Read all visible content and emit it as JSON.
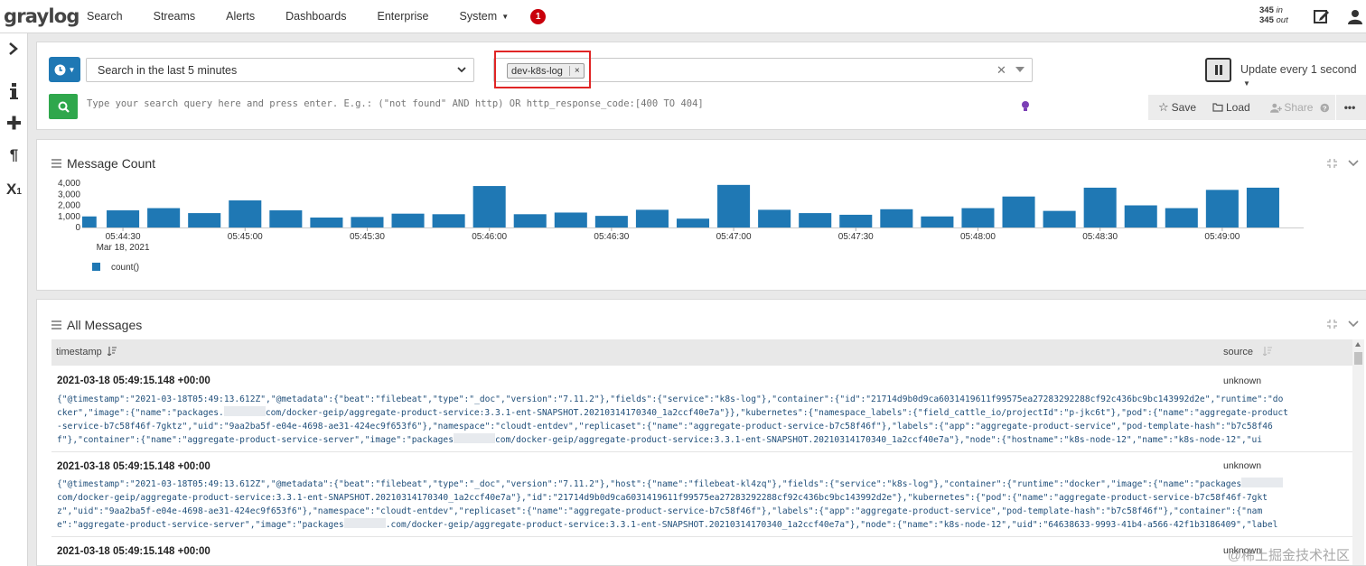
{
  "app": {
    "logo": "graylog"
  },
  "nav": {
    "items": [
      "Search",
      "Streams",
      "Alerts",
      "Dashboards",
      "Enterprise",
      "System"
    ],
    "notification_count": "1"
  },
  "throughput": {
    "in_value": "345",
    "in_label": "in",
    "out_value": "345",
    "out_label": "out"
  },
  "sidebar": {
    "icons": [
      "chevron-right-icon",
      "info-icon",
      "plus-icon",
      "paragraph-icon",
      "subscript-icon"
    ]
  },
  "search": {
    "time_range": "Search in the last 5 minutes",
    "stream_tag": "dev-k8s-log",
    "stream_tag_remove": "×",
    "stream_clear": "✕",
    "refresh_label": "Update every 1 second",
    "query_placeholder": "Type your search query here and press enter. E.g.: (\"not found\" AND http) OR http_response_code:[400 TO 404]",
    "query_value": "",
    "save_label": "Save",
    "load_label": "Load",
    "share_label": "Share"
  },
  "message_count": {
    "title": "Message Count",
    "date_label": "Mar 18, 2021",
    "legend": "count()"
  },
  "chart_data": {
    "type": "bar",
    "color": "#1f78b4",
    "ylim": [
      0,
      4000
    ],
    "y_ticks": [
      "0",
      "1,000",
      "2,000",
      "3,000",
      "4,000"
    ],
    "x_tick_labels": [
      "05:44:30",
      "05:45:00",
      "05:45:30",
      "05:46:00",
      "05:46:30",
      "05:47:00",
      "05:47:30",
      "05:48:00",
      "05:48:30",
      "05:49:00"
    ],
    "series": [
      {
        "name": "count()",
        "values": [
          1000,
          1550,
          1750,
          1300,
          2450,
          1550,
          900,
          950,
          1250,
          1200,
          3750,
          1200,
          1350,
          1050,
          1600,
          800,
          3850,
          1600,
          1300,
          1150,
          1650,
          1000,
          1750,
          2800,
          1500,
          3600,
          2000,
          1750,
          3400,
          3600
        ]
      }
    ],
    "grid": false,
    "legend_position": "bottom-left"
  },
  "all_messages": {
    "title": "All Messages",
    "col_timestamp": "timestamp",
    "col_source": "source",
    "rows": [
      {
        "timestamp": "2021-03-18 05:49:15.148 +00:00",
        "source": "unknown",
        "lines": [
          "{\"@timestamp\":\"2021-03-18T05:49:13.612Z\",\"@metadata\":{\"beat\":\"filebeat\",\"type\":\"_doc\",\"version\":\"7.11.2\"},\"fields\":{\"service\":\"k8s-log\"},\"container\":{\"id\":\"21714d9b0d9ca6031419611f99575ea27283292288cf92c436bc9bc143992d2e\",\"runtime\":\"do",
          "cker\",\"image\":{\"name\":\"packages.",
          "com/docker-geip/aggregate-product-service:3.3.1-ent-SNAPSHOT.20210314170340_1a2ccf40e7a\"}},\"kubernetes\":{\"namespace_labels\":{\"field_cattle_io/projectId\":\"p-jkc6t\"},\"pod\":{\"name\":\"aggregate-product",
          "-service-b7c58f46f-7gktz\",\"uid\":\"9aa2ba5f-e04e-4698-ae31-424ec9f653f6\"},\"namespace\":\"cloudt-entdev\",\"replicaset\":{\"name\":\"aggregate-product-service-b7c58f46f\"},\"labels\":{\"app\":\"aggregate-product-service\",\"pod-template-hash\":\"b7c58f46",
          "f\"},\"container\":{\"name\":\"aggregate-product-service-server\",\"image\":\"packages",
          "com/docker-geip/aggregate-product-service:3.3.1-ent-SNAPSHOT.20210314170340_1a2ccf40e7a\"},\"node\":{\"hostname\":\"k8s-node-12\",\"name\":\"k8s-node-12\",\"ui"
        ]
      },
      {
        "timestamp": "2021-03-18 05:49:15.148 +00:00",
        "source": "unknown",
        "lines": [
          "{\"@timestamp\":\"2021-03-18T05:49:13.612Z\",\"@metadata\":{\"beat\":\"filebeat\",\"type\":\"_doc\",\"version\":\"7.11.2\"},\"host\":{\"name\":\"filebeat-kl4zq\"},\"fields\":{\"service\":\"k8s-log\"},\"container\":{\"runtime\":\"docker\",\"image\":{\"name\":\"packages",
          "com/docker-geip/aggregate-product-service:3.3.1-ent-SNAPSHOT.20210314170340_1a2ccf40e7a\"},\"id\":\"21714d9b0d9ca6031419611f99575ea27283292288cf92c436bc9bc143992d2e\"},\"kubernetes\":{\"pod\":{\"name\":\"aggregate-product-service-b7c58f46f-7gkt",
          "z\",\"uid\":\"9aa2ba5f-e04e-4698-ae31-424ec9f653f6\"},\"namespace\":\"cloudt-entdev\",\"replicaset\":{\"name\":\"aggregate-product-service-b7c58f46f\"},\"labels\":{\"app\":\"aggregate-product-service\",\"pod-template-hash\":\"b7c58f46f\"},\"container\":{\"nam",
          "e\":\"aggregate-product-service-server\",\"image\":\"packages",
          ".com/docker-geip/aggregate-product-service:3.3.1-ent-SNAPSHOT.20210314170340_1a2ccf40e7a\"},\"node\":{\"name\":\"k8s-node-12\",\"uid\":\"64638633-9993-41b4-a566-42f1b3186409\",\"label"
        ]
      },
      {
        "timestamp": "2021-03-18 05:49:15.148 +00:00",
        "source": "unknown",
        "lines": []
      }
    ]
  },
  "watermark": "@稀土掘金技术社区"
}
